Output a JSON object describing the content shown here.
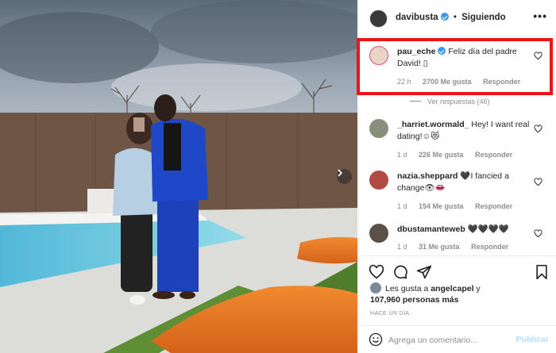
{
  "header": {
    "username": "davibusta",
    "separator": "•",
    "following_label": "Siguiendo",
    "more_label": "•••"
  },
  "comments": [
    {
      "username": "pau_eche",
      "verified": true,
      "text": "Feliz día del padre David! ",
      "emoji": "▯",
      "time": "22 h",
      "likes": "2700 Me gusta",
      "reply": "Responder"
    },
    {
      "username": "_harriet.wormald_",
      "text": " Hey! I want real dating!",
      "emoji": "☺😻",
      "time": "1 d",
      "likes": "226 Me gusta",
      "reply": "Responder"
    },
    {
      "username": "nazia.sheppard",
      "text": "I fancied a change",
      "prefix_emoji": "🖤",
      "emoji": "👁👄",
      "time": "1 d",
      "likes": "154 Me gusta",
      "reply": "Responder"
    },
    {
      "username": "dbustamanteweb",
      "text": " ",
      "emoji": "🖤🖤🖤🖤",
      "time": "1 d",
      "likes": "31 Me gusta",
      "reply": "Responder"
    }
  ],
  "view_replies": "Ver respuestas (46)",
  "likes_line1_prefix": "Les gusta a ",
  "likes_user": "angelcapel",
  "likes_line1_suffix": " y",
  "likes_line2": "107,960 personas más",
  "timestamp": "HACE UN DÍA",
  "comment_input": {
    "placeholder": "Agrega un comentario...",
    "value": ""
  },
  "publish_label": "Publicar",
  "next_icon": "chevron-right-icon",
  "colors": {
    "accent_blue": "#3897f0",
    "highlight_red": "#e8161b",
    "publish_disabled": "#b2dffc",
    "muted_text": "#8e8e8e"
  }
}
